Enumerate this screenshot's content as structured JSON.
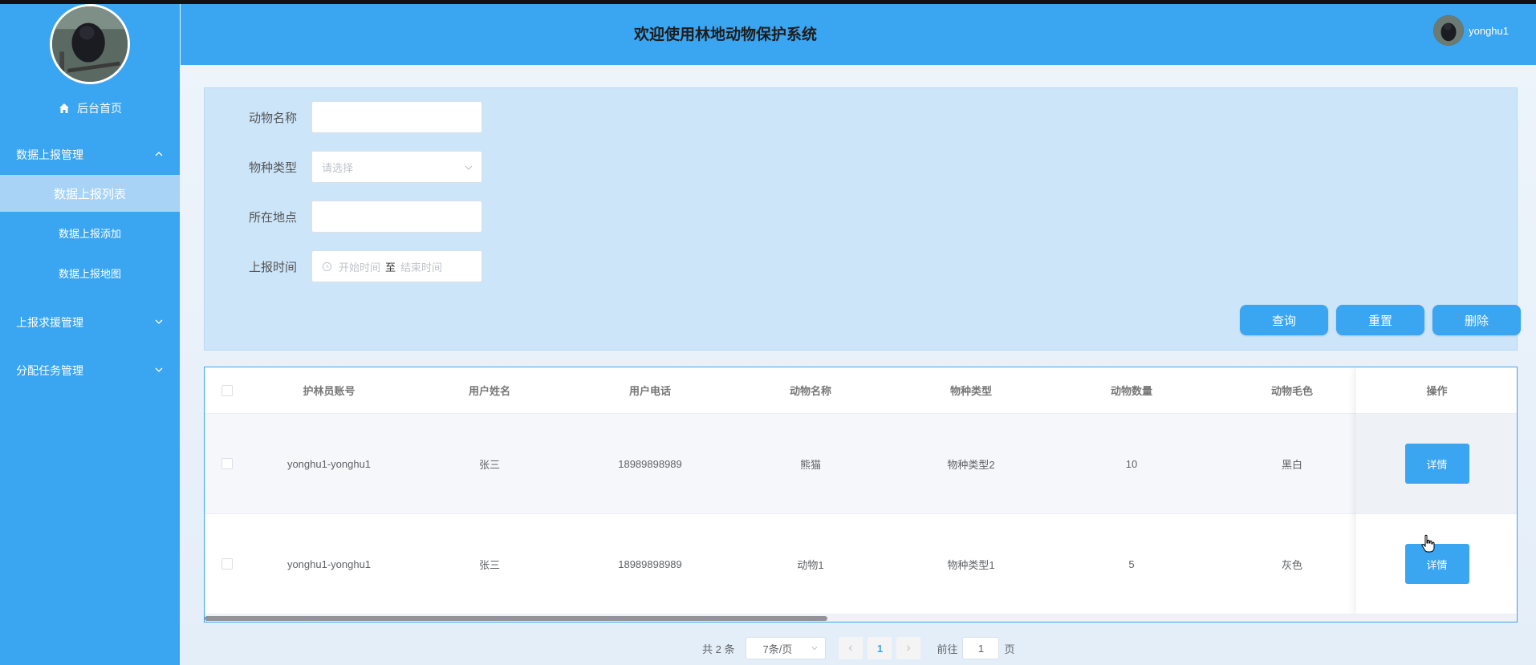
{
  "header": {
    "title": "欢迎使用林地动物保护系统",
    "username": "yonghu1"
  },
  "sidebar": {
    "home": "后台首页",
    "groups": [
      {
        "label": "数据上报管理",
        "expanded": true,
        "items": [
          {
            "label": "数据上报列表",
            "active": true
          },
          {
            "label": "数据上报添加"
          },
          {
            "label": "数据上报地图"
          }
        ]
      },
      {
        "label": "上报求援管理",
        "expanded": false
      },
      {
        "label": "分配任务管理",
        "expanded": false
      }
    ]
  },
  "search": {
    "fields": [
      {
        "label": "动物名称",
        "value": ""
      },
      {
        "label": "物种类型",
        "placeholder": "请选择"
      },
      {
        "label": "所在地点",
        "value": ""
      },
      {
        "label": "上报时间",
        "start_placeholder": "开始时间",
        "separator": "至",
        "end_placeholder": "结束时间"
      }
    ],
    "buttons": {
      "query": "查询",
      "reset": "重置",
      "delete": "删除"
    }
  },
  "table": {
    "columns": [
      "护林员账号",
      "用户姓名",
      "用户电话",
      "动物名称",
      "物种类型",
      "动物数量",
      "动物毛色",
      "操作"
    ],
    "rows": [
      {
        "account": "yonghu1-yonghu1",
        "name": "张三",
        "phone": "18989898989",
        "animal": "熊猫",
        "species": "物种类型2",
        "count": "10",
        "color": "黑白",
        "action": "详情"
      },
      {
        "account": "yonghu1-yonghu1",
        "name": "张三",
        "phone": "18989898989",
        "animal": "动物1",
        "species": "物种类型1",
        "count": "5",
        "color": "灰色",
        "action": "详情"
      }
    ]
  },
  "pagination": {
    "total": "共 2 条",
    "page_size": "7条/页",
    "current": "1",
    "goto_prefix": "前往",
    "goto_value": "1",
    "goto_suffix": "页"
  },
  "colors": {
    "primary": "#3aa5f0",
    "panel": "#cce5f9",
    "active_item": "#a8d3f7"
  }
}
